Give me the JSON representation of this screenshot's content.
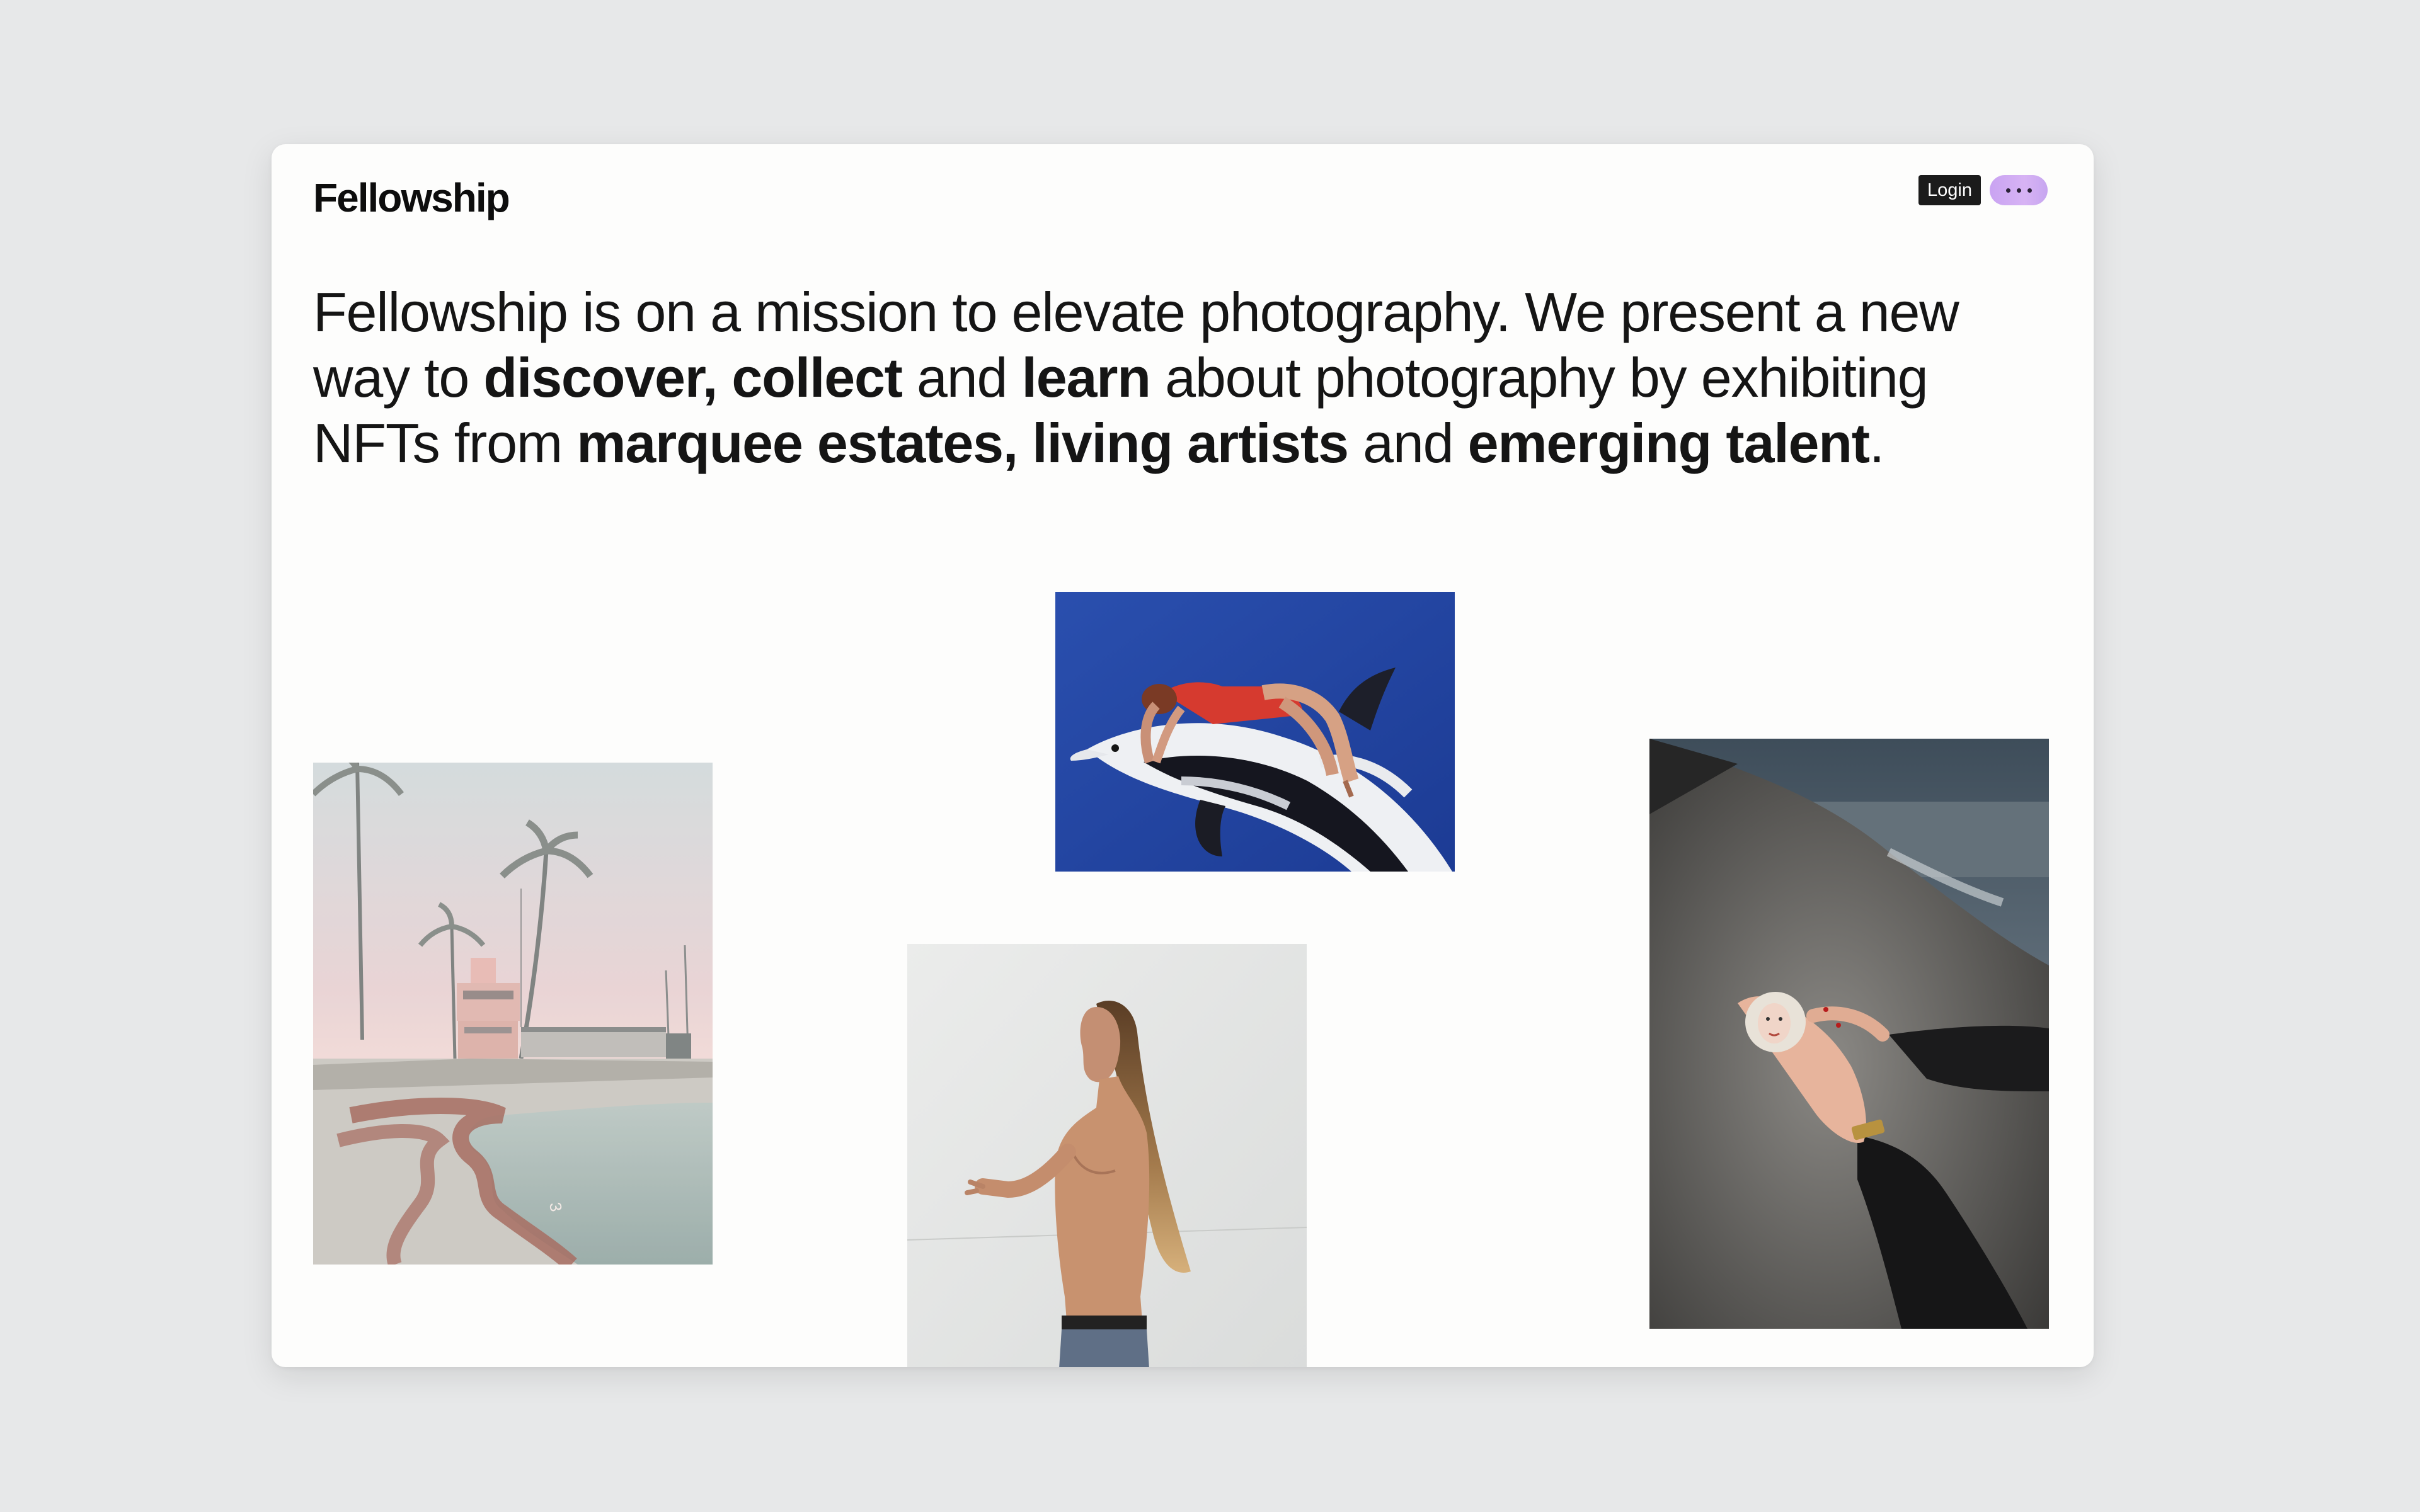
{
  "brand": {
    "name": "Fellowship"
  },
  "header": {
    "login_label": "Login",
    "more_icon": "ellipsis-icon",
    "more_button_gradient": [
      "#c9a3f2",
      "#d7b3f4"
    ]
  },
  "mission": {
    "s1": "Fellowship is on a mission to elevate photography. We present a new way to ",
    "b1": "discover, collect",
    "s2": " and ",
    "b2": "learn",
    "s3": " about photography by exhibiting NFTs from ",
    "b3": "marquee estates, living artists",
    "s4": " and ",
    "b4": "emerging talent",
    "s5": "."
  },
  "gallery": {
    "pool_lane_number": "3"
  },
  "colors": {
    "background": "#e7e8e9",
    "card": "#fdfdfc",
    "text": "#151515",
    "login_bg": "#1b1b1b"
  }
}
